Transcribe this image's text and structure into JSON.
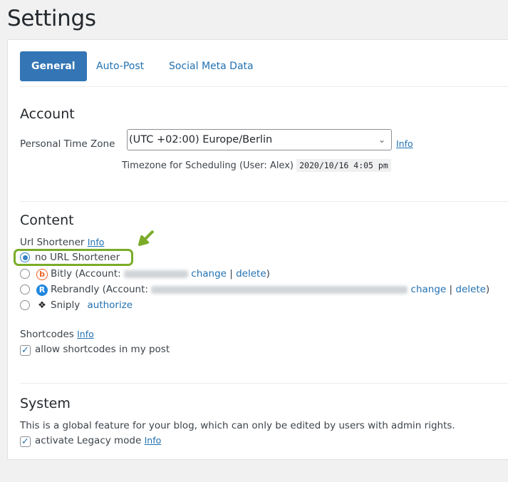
{
  "page": {
    "title": "Settings"
  },
  "tabs": [
    {
      "label": "General",
      "active": true
    },
    {
      "label": "Auto-Post",
      "active": false
    },
    {
      "label": "Social Meta Data",
      "active": false
    }
  ],
  "account": {
    "heading": "Account",
    "timezone_label": "Personal Time Zone",
    "timezone_value": "(UTC +02:00) Europe/Berlin",
    "info_link": "Info",
    "scheduling_text": "Timezone for Scheduling (User: Alex)",
    "scheduling_time": "2020/10/16 4:05 pm"
  },
  "content": {
    "heading": "Content",
    "url_shortener_label": "Url Shortener",
    "info_link": "Info",
    "options": {
      "none": "no URL Shortener",
      "bitly": "Bitly (Account:",
      "bitly_close": ")",
      "rebrandly": "Rebrandly (Account:",
      "rebrandly_close": ")",
      "sniply": "Sniply"
    },
    "actions": {
      "change": "change",
      "separator": "|",
      "delete": "delete",
      "authorize": "authorize"
    },
    "selected": "none",
    "shortcodes_label": "Shortcodes",
    "shortcodes_info": "Info",
    "allow_shortcodes": "allow shortcodes in my post",
    "allow_shortcodes_checked": true
  },
  "system": {
    "heading": "System",
    "description": "This is a global feature for your blog, which can only be edited by users with admin rights.",
    "legacy_label": "activate Legacy mode",
    "legacy_info": "Info",
    "legacy_checked": true
  },
  "colors": {
    "accent": "#3375b5",
    "link": "#2271b1",
    "highlight": "#7aac29"
  }
}
